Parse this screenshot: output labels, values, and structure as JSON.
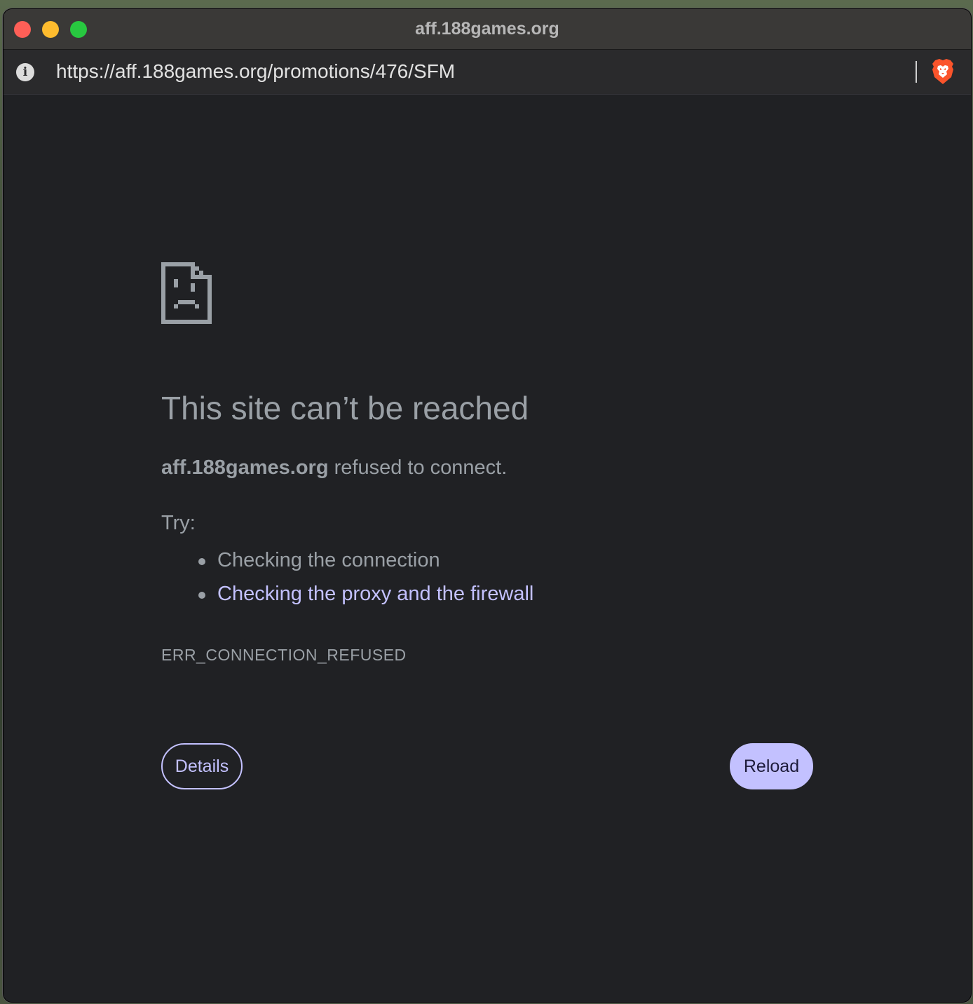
{
  "window": {
    "title": "aff.188games.org"
  },
  "addressbar": {
    "url": "https://aff.188games.org/promotions/476/SFM",
    "info_icon": "info-icon",
    "extension_icon": "brave-lion-icon"
  },
  "error_page": {
    "icon": "sad-document-icon",
    "heading": "This site can’t be reached",
    "host": "aff.188games.org",
    "message": " refused to connect.",
    "try_label": "Try:",
    "suggestions": [
      "Checking the connection",
      "Checking the proxy and the firewall"
    ],
    "error_code": "ERR_CONNECTION_REFUSED",
    "details_button": "Details",
    "reload_button": "Reload"
  },
  "colors": {
    "page_background": "#202124",
    "text_secondary": "#9aa0a6",
    "link_accent": "#c3c1ff",
    "titlebar": "#3a3937",
    "close": "#fe5f57",
    "minimize": "#febc2e",
    "maximize": "#28c840"
  }
}
